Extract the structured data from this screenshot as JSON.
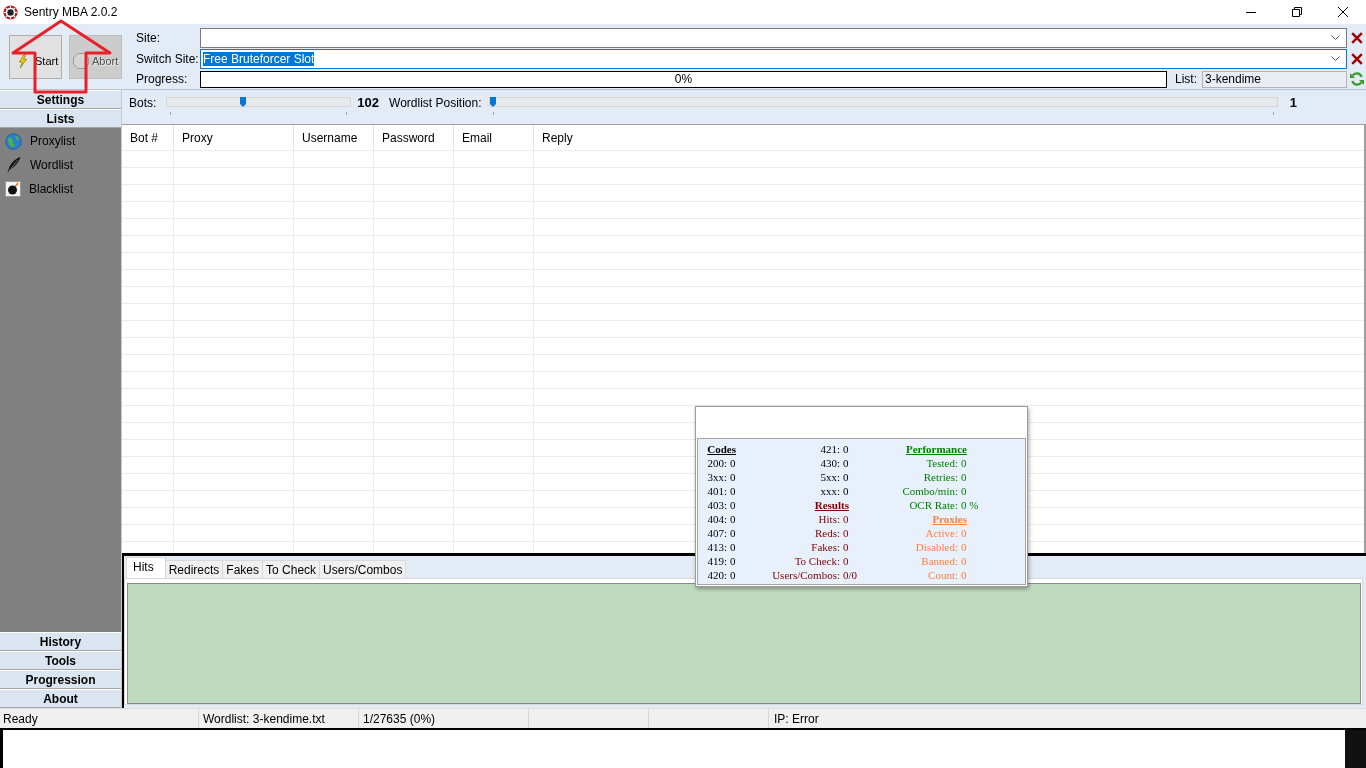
{
  "window": {
    "title": "Sentry MBA 2.0.2"
  },
  "toolbar": {
    "buttons": [
      {
        "label": "Start",
        "disabled": false
      },
      {
        "label": "Abort",
        "disabled": true
      }
    ],
    "site": {
      "label": "Site:",
      "focused": false
    },
    "switch_site": {
      "label": "Switch Site:",
      "value": "Free Bruteforcer Slot",
      "focused": true,
      "text_selected": true
    },
    "progress": {
      "label": "Progress:",
      "level": 0,
      "reading": "0%"
    },
    "list": {
      "label": "List:",
      "value": "3-kendime"
    }
  },
  "sidebar": {
    "top_sections": [
      {
        "label": "Settings"
      },
      {
        "label": "Lists"
      }
    ],
    "items": [
      {
        "label": "Proxylist"
      },
      {
        "label": "Wordlist"
      },
      {
        "label": "Blacklist"
      }
    ],
    "bottom_sections": [
      {
        "label": "History"
      },
      {
        "label": "Tools"
      },
      {
        "label": "Progression"
      },
      {
        "label": "About"
      }
    ]
  },
  "sliders": [
    {
      "label": "Bots:",
      "level": 0.41,
      "reading": "102"
    },
    {
      "label": "Wordlist Position:",
      "level": 0,
      "reading": "1"
    }
  ],
  "table": {
    "columns": [
      "Bot #",
      "Proxy",
      "Username",
      "Password",
      "Email",
      "Reply"
    ]
  },
  "result_tabs": [
    {
      "label": "Hits",
      "selected": true
    },
    {
      "label": "Redirects",
      "selected": false
    },
    {
      "label": "Fakes",
      "selected": false
    },
    {
      "label": "To Check",
      "selected": false
    },
    {
      "label": "Users/Combos",
      "selected": false
    }
  ],
  "stats_panel": {
    "columns": [
      {
        "groups": [
          {
            "heading": "Codes",
            "color": "#000000",
            "rows": [
              {
                "label": "200:",
                "value": "0"
              },
              {
                "label": "3xx:",
                "value": "0"
              },
              {
                "label": "401:",
                "value": "0"
              },
              {
                "label": "403:",
                "value": "0"
              },
              {
                "label": "404:",
                "value": "0"
              },
              {
                "label": "407:",
                "value": "0"
              },
              {
                "label": "413:",
                "value": "0"
              },
              {
                "label": "419:",
                "value": "0"
              },
              {
                "label": "420:",
                "value": "0"
              }
            ]
          }
        ]
      },
      {
        "groups": [
          {
            "rows": [
              {
                "label": "421:",
                "value": "0"
              },
              {
                "label": "430:",
                "value": "0"
              },
              {
                "label": "5xx:",
                "value": "0"
              },
              {
                "label": "xxx:",
                "value": "0"
              }
            ]
          },
          {
            "heading": "Results",
            "color": "#800000",
            "rows": [
              {
                "label": "Hits:",
                "value": "0"
              },
              {
                "label": "Reds:",
                "value": "0"
              },
              {
                "label": "Fakes:",
                "value": "0"
              },
              {
                "label": "To Check:",
                "value": "0"
              },
              {
                "label": "Users/Combos:",
                "value": "0/0"
              }
            ]
          }
        ]
      },
      {
        "groups": [
          {
            "heading": "Performance",
            "color": "#008000",
            "rows": [
              {
                "label": "Tested:",
                "value": "0"
              },
              {
                "label": "Retries:",
                "value": "0"
              },
              {
                "label": "Combo/min:",
                "value": "0"
              },
              {
                "label": "OCR Rate:",
                "value": "0 %"
              }
            ]
          },
          {
            "heading": "Proxies",
            "color": "#ff8040",
            "rows": [
              {
                "label": "Active:",
                "value": "0"
              },
              {
                "label": "Disabled:",
                "value": "0"
              },
              {
                "label": "Banned:",
                "value": "0"
              },
              {
                "label": "Count:",
                "value": "0"
              }
            ]
          }
        ]
      }
    ]
  },
  "status_bar": [
    "Ready",
    "Wordlist: 3-kendime.txt",
    "1/27635 (0%)",
    "IP: Error"
  ]
}
